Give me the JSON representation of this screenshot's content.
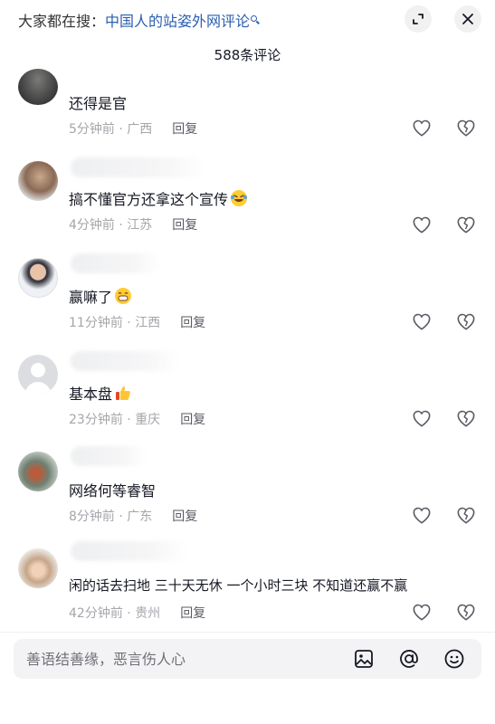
{
  "header": {
    "search_prefix": "大家都在搜：",
    "search_keyword": "中国人的站姿外网评论",
    "comment_count": "588条评论"
  },
  "comments": [
    {
      "text": "还得是官",
      "time": "5分钟前",
      "location": "广西",
      "reply": "回复"
    },
    {
      "text": "搞不懂官方还拿这个宣传",
      "time": "4分钟前",
      "location": "江苏",
      "reply": "回复",
      "emoji": "laughing-tears-emoji"
    },
    {
      "text": "赢嘛了",
      "time": "11分钟前",
      "location": "江西",
      "reply": "回复",
      "emoji": "grinning-emoji"
    },
    {
      "text": "基本盘",
      "time": "23分钟前",
      "location": "重庆",
      "reply": "回复",
      "emoji": "thumbs-up-emoji"
    },
    {
      "text": "网络何等睿智",
      "time": "8分钟前",
      "location": "广东",
      "reply": "回复"
    },
    {
      "text": "闲的话去扫地 三十天无休 一个小时三块 不知道还赢不赢",
      "time": "42分钟前",
      "location": "贵州",
      "reply": "回复"
    }
  ],
  "input": {
    "placeholder": "善语结善缘，恶言伤人心"
  },
  "icons": {
    "expand": "expand-icon",
    "close": "close-icon",
    "like": "heart-outline-icon",
    "dislike": "broken-heart-icon",
    "image": "image-icon",
    "mention": "at-icon",
    "emoji": "smiley-icon"
  },
  "colors": {
    "keyword": "#2a5fb0",
    "meta": "#a5a6ab",
    "text": "#161823"
  }
}
